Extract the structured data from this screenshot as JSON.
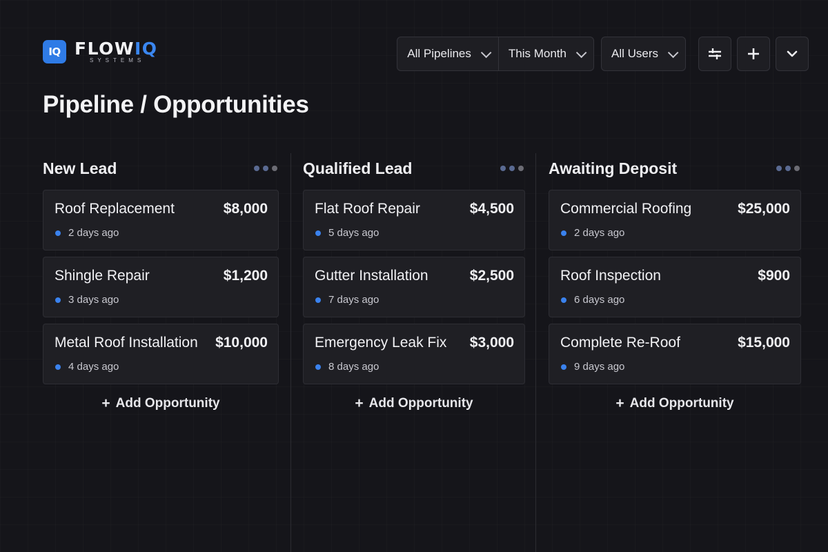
{
  "brand": {
    "mark": "IQ",
    "name_main": "FLOW",
    "name_accent": "IQ",
    "subtitle": "SYSTEMS"
  },
  "toolbar": {
    "pipeline_filter": "All Pipelines",
    "period_filter": "This Month",
    "user_filter": "All Users",
    "icons": [
      "sliders-icon",
      "plus-icon",
      "chevron-down-icon"
    ]
  },
  "page_title": "Pipeline / Opportunities",
  "add_label": "Add Opportunity",
  "colors": {
    "accent": "#2f7be6",
    "status_dot": "#3a82ee",
    "background": "#15151a"
  },
  "columns": [
    {
      "title": "New Lead",
      "cards": [
        {
          "name": "Roof Replacement",
          "value": "$8,000",
          "age": "2 days ago"
        },
        {
          "name": "Shingle Repair",
          "value": "$1,200",
          "age": "3 days ago"
        },
        {
          "name": "Metal Roof Installation",
          "value": "$10,000",
          "age": "4 days ago"
        }
      ]
    },
    {
      "title": "Qualified Lead",
      "cards": [
        {
          "name": "Flat Roof Repair",
          "value": "$4,500",
          "age": "5 days ago"
        },
        {
          "name": "Gutter Installation",
          "value": "$2,500",
          "age": "7 days ago"
        },
        {
          "name": "Emergency Leak Fix",
          "value": "$3,000",
          "age": "8 days ago"
        }
      ]
    },
    {
      "title": "Awaiting Deposit",
      "cards": [
        {
          "name": "Commercial Roofing",
          "value": "$25,000",
          "age": "2 days ago"
        },
        {
          "name": "Roof Inspection",
          "value": "$900",
          "age": "6 days ago"
        },
        {
          "name": "Complete Re-Roof",
          "value": "$15,000",
          "age": "9 days ago"
        }
      ]
    }
  ]
}
